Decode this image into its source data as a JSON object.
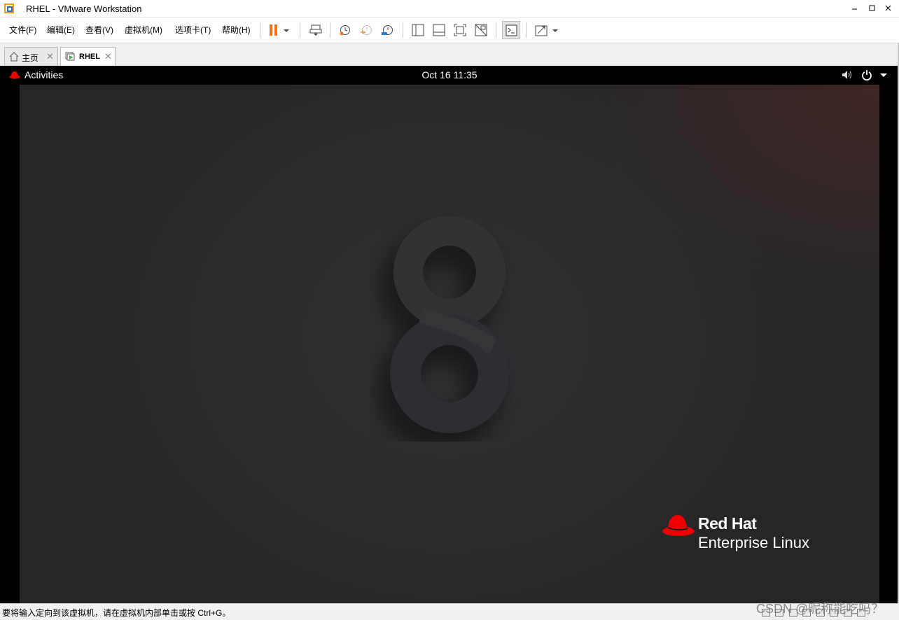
{
  "window": {
    "title": "RHEL - VMware Workstation",
    "icons": {
      "app": "vmware-app-icon",
      "minimize": "minimize-icon",
      "maximize": "maximize-icon",
      "close": "close-icon"
    }
  },
  "menu": {
    "items": [
      "文件(F)",
      "编辑(E)",
      "查看(V)",
      "虚拟机(M)",
      "选项卡(T)",
      "帮助(H)"
    ]
  },
  "toolbar": {
    "buttons": [
      {
        "name": "pause-icon",
        "color": "#f2711c"
      },
      {
        "name": "dropdown-arrow-icon"
      },
      {
        "name": "send-ctrl-alt-del-icon"
      },
      {
        "name": "snapshot-take-icon"
      },
      {
        "name": "snapshot-revert-icon"
      },
      {
        "name": "snapshot-manager-icon"
      },
      {
        "name": "show-library-icon"
      },
      {
        "name": "thumbnail-bar-icon"
      },
      {
        "name": "full-screen-icon"
      },
      {
        "name": "unity-mode-icon"
      },
      {
        "name": "console-view-icon"
      },
      {
        "name": "stretch-guest-icon"
      },
      {
        "name": "dropdown-arrow-icon"
      }
    ]
  },
  "tabs": [
    {
      "label": "主页",
      "icon": "home-icon",
      "active": false
    },
    {
      "label": "RHEL",
      "icon": "vm-running-icon",
      "active": true
    }
  ],
  "guest": {
    "activities_label": "Activities",
    "clock": "Oct 16  11:35",
    "system_icons": [
      "volume-icon",
      "power-icon",
      "menu-arrow-icon"
    ],
    "logo_line1": "Red Hat",
    "logo_line2": "Enterprise Linux",
    "wallpaper_numeral": "8",
    "colors": {
      "redhat_red": "#ee0000",
      "wallpaper": "#2b2b2d"
    }
  },
  "statusbar": {
    "hint": "要将输入定向到该虚拟机，请在虚拟机内部单击或按 Ctrl+G。",
    "watermark": "CSDN @昵称能吃吗？"
  }
}
